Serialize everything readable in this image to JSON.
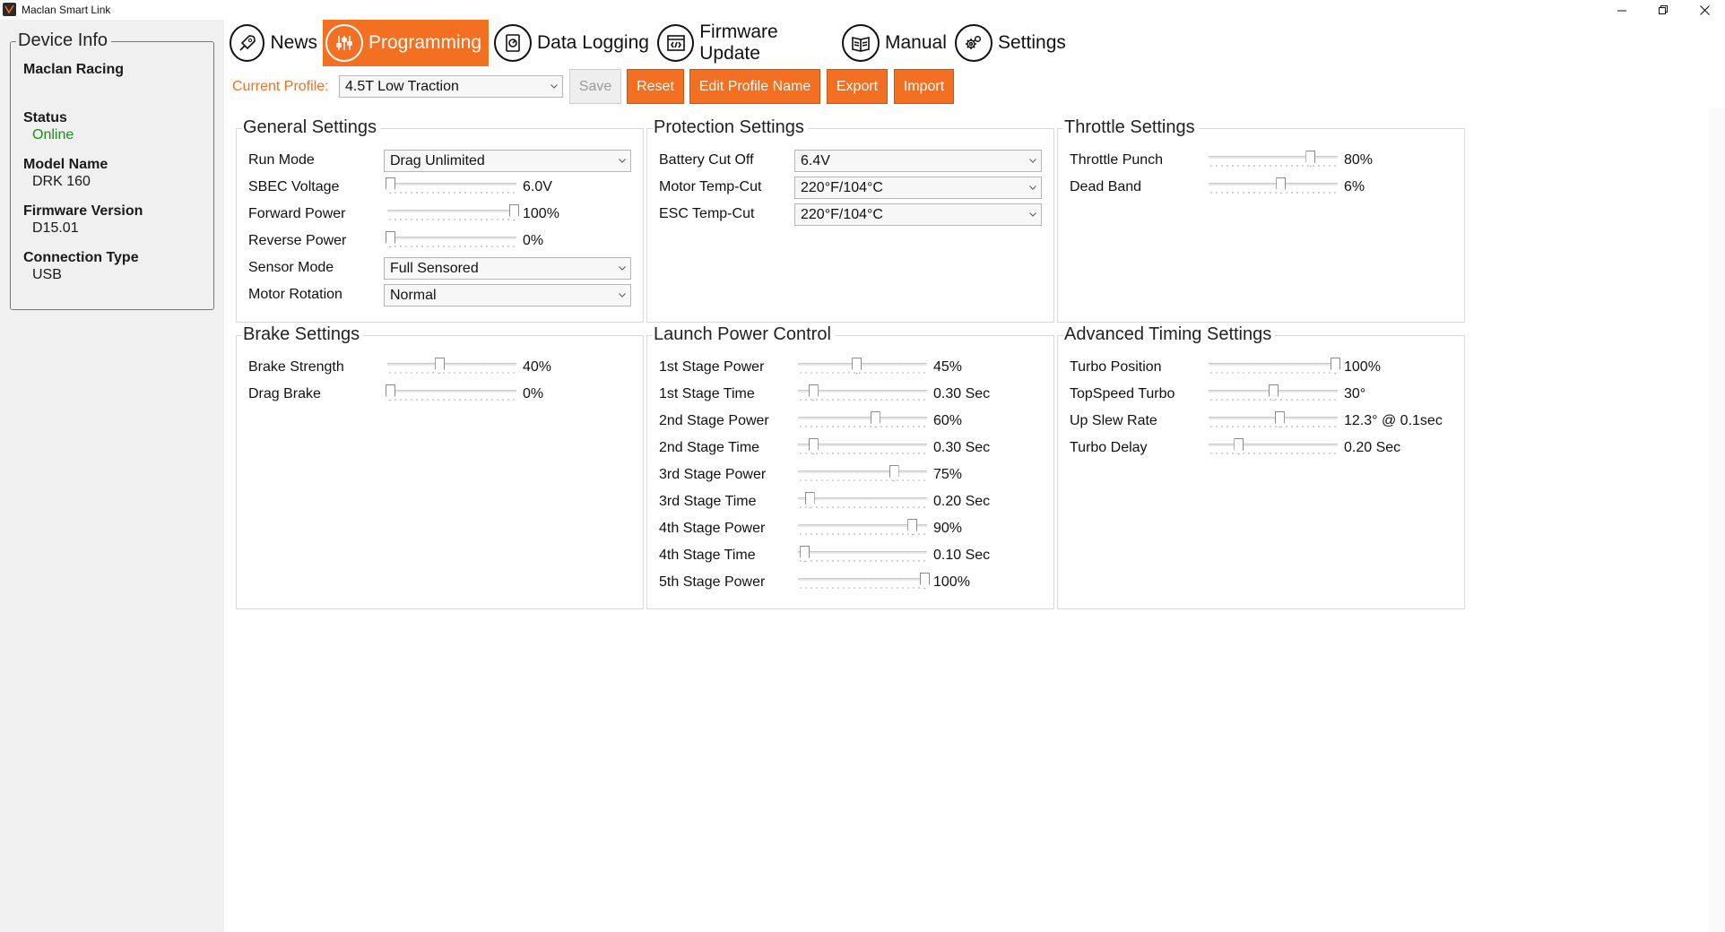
{
  "window": {
    "title": "Maclan Smart Link"
  },
  "device_info": {
    "legend": "Device Info",
    "company": "Maclan Racing",
    "status_label": "Status",
    "status_value": "Online",
    "model_label": "Model Name",
    "model_value": "DRK 160",
    "firmware_label": "Firmware Version",
    "firmware_value": "D15.01",
    "connection_label": "Connection Type",
    "connection_value": "USB"
  },
  "nav": {
    "news": "News",
    "programming": "Programming",
    "data_logging": "Data Logging",
    "firmware_update": "Firmware Update",
    "manual": "Manual",
    "settings": "Settings"
  },
  "profile": {
    "label": "Current Profile:",
    "selected": "4.5T Low Traction",
    "save": "Save",
    "reset": "Reset",
    "edit_name": "Edit Profile Name",
    "export": "Export",
    "import": "Import"
  },
  "general": {
    "title": "General Settings",
    "run_mode_label": "Run Mode",
    "run_mode_value": "Drag Unlimited",
    "sbec_label": "SBEC Voltage",
    "sbec_value": "6.0V",
    "sbec_pos": 0.0,
    "forward_label": "Forward Power",
    "forward_value": "100%",
    "forward_pos": 1.0,
    "reverse_label": "Reverse Power",
    "reverse_value": "0%",
    "reverse_pos": 0.0,
    "sensor_label": "Sensor Mode",
    "sensor_value": "Full Sensored",
    "rotation_label": "Motor Rotation",
    "rotation_value": "Normal"
  },
  "protection": {
    "title": "Protection Settings",
    "battery_label": "Battery Cut Off",
    "battery_value": "6.4V",
    "motor_temp_label": "Motor Temp-Cut",
    "motor_temp_value": "220°F/104°C",
    "esc_temp_label": "ESC Temp-Cut",
    "esc_temp_value": "220°F/104°C"
  },
  "throttle": {
    "title": "Throttle Settings",
    "punch_label": "Throttle Punch",
    "punch_value": "80%",
    "punch_pos": 0.8,
    "deadband_label": "Dead Band",
    "deadband_value": "6%",
    "deadband_pos": 0.56
  },
  "brake": {
    "title": "Brake Settings",
    "strength_label": "Brake Strength",
    "strength_value": "40%",
    "strength_pos": 0.4,
    "drag_label": "Drag Brake",
    "drag_value": "0%",
    "drag_pos": 0.0
  },
  "launch": {
    "title": "Launch Power Control",
    "rows": [
      {
        "label": "1st Stage Power",
        "value": "45%",
        "pos": 0.45
      },
      {
        "label": "1st Stage Time",
        "value": "0.30 Sec",
        "pos": 0.1
      },
      {
        "label": "2nd Stage Power",
        "value": "60%",
        "pos": 0.6
      },
      {
        "label": "2nd Stage Time",
        "value": "0.30 Sec",
        "pos": 0.1
      },
      {
        "label": "3rd Stage Power",
        "value": "75%",
        "pos": 0.75
      },
      {
        "label": "3rd Stage Time",
        "value": "0.20 Sec",
        "pos": 0.07
      },
      {
        "label": "4th Stage Power",
        "value": "90%",
        "pos": 0.9
      },
      {
        "label": "4th Stage Time",
        "value": "0.10 Sec",
        "pos": 0.03
      },
      {
        "label": "5th Stage Power",
        "value": "100%",
        "pos": 1.0
      }
    ]
  },
  "timing": {
    "title": "Advanced Timing Settings",
    "rows": [
      {
        "label": "Turbo Position",
        "value": "100%",
        "pos": 1.0
      },
      {
        "label": "TopSpeed Turbo",
        "value": "30°",
        "pos": 0.5
      },
      {
        "label": "Up Slew Rate",
        "value": "12.3° @ 0.1sec",
        "pos": 0.55
      },
      {
        "label": "Turbo Delay",
        "value": "0.20 Sec",
        "pos": 0.22
      }
    ]
  },
  "colors": {
    "accent": "#f36f21",
    "online": "#1e8a1e",
    "sidebar_bg": "#f0f0f0"
  }
}
